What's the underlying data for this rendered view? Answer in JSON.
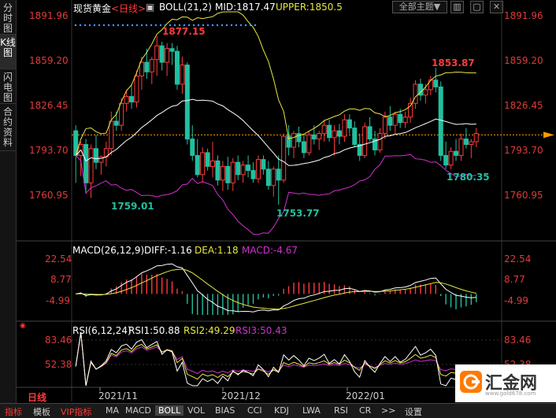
{
  "sidebar": {
    "tabs": [
      "分时图",
      "K线图",
      "闪电图",
      "合约资料"
    ]
  },
  "header": {
    "symbol": "现货黄金",
    "period": "<日线>",
    "boll": "BOLL(21,2)",
    "mid": "MID:1817.47",
    "upper": "UPPER:1850.5",
    "theme_select": "全部主题▼",
    "ctrl_icons": [
      "▥",
      "▢",
      "✕"
    ]
  },
  "price_axis": {
    "left": [
      "1891.96",
      "1859.20",
      "1826.45",
      "1793.70",
      "1760.95"
    ],
    "right": [
      "1891.96",
      "1859.20",
      "1826.45",
      "1793.70",
      "1760.95"
    ]
  },
  "annotations": {
    "high1": "1877.15",
    "low1": "1759.01",
    "low2": "1753.77",
    "high2": "1853.87",
    "low3": "1780.35"
  },
  "macd_header": {
    "name": "MACD(26,12,9)",
    "diff": "DIFF:-1.16",
    "dea": "DEA:1.18",
    "macd": "MACD:-4.67"
  },
  "macd_axis": [
    "22.54",
    "8.77",
    "-4.99"
  ],
  "rsi_header": {
    "name": "RSI(6,12,24)",
    "rsi1": "RSI1:50.88",
    "rsi2": "RSI2:49.29",
    "rsi3": "RSI3:50.43"
  },
  "rsi_axis": [
    "83.46",
    "52.38"
  ],
  "time_axis": {
    "period_label": "日线",
    "dates": [
      "2021/11",
      "2021/12",
      "2022/01",
      "2"
    ]
  },
  "bottom_tabs": [
    "指标",
    "模板",
    "VIP指标",
    "MA",
    "MACD",
    "BOLL",
    "VOL",
    "BIAS",
    "CCI",
    "KDJ",
    "LWA",
    "RSI",
    "CR",
    ">>",
    "设置"
  ],
  "logo": {
    "text": "汇金网",
    "url": "www.gold678.com"
  },
  "colors": {
    "up": "#ff3b3b",
    "down": "#20c0a0",
    "mid": "#ffffff",
    "upper_band": "#e8e840",
    "lower_band": "#d030d0",
    "axis": "#e03a3a",
    "current": "#ff9900"
  },
  "chart_data": {
    "type": "candlestick",
    "title": "现货黄金 日线",
    "ylim": [
      1740,
      1895
    ],
    "current_price": 1805,
    "candles": [
      [
        1808,
        1812,
        1770,
        1790
      ],
      [
        1790,
        1800,
        1775,
        1798
      ],
      [
        1798,
        1802,
        1762,
        1770
      ],
      [
        1770,
        1798,
        1759,
        1795
      ],
      [
        1795,
        1805,
        1780,
        1785
      ],
      [
        1785,
        1790,
        1776,
        1789
      ],
      [
        1789,
        1800,
        1782,
        1795
      ],
      [
        1795,
        1822,
        1790,
        1815
      ],
      [
        1815,
        1822,
        1808,
        1812
      ],
      [
        1812,
        1832,
        1808,
        1828
      ],
      [
        1828,
        1838,
        1822,
        1833
      ],
      [
        1833,
        1842,
        1824,
        1829
      ],
      [
        1829,
        1852,
        1825,
        1848
      ],
      [
        1848,
        1862,
        1838,
        1858
      ],
      [
        1858,
        1868,
        1846,
        1851
      ],
      [
        1851,
        1862,
        1842,
        1860
      ],
      [
        1860,
        1877,
        1848,
        1870
      ],
      [
        1870,
        1873,
        1852,
        1858
      ],
      [
        1858,
        1872,
        1848,
        1868
      ],
      [
        1868,
        1872,
        1856,
        1866
      ],
      [
        1866,
        1870,
        1838,
        1842
      ],
      [
        1842,
        1862,
        1835,
        1856
      ],
      [
        1856,
        1858,
        1798,
        1802
      ],
      [
        1802,
        1812,
        1786,
        1790
      ],
      [
        1790,
        1802,
        1774,
        1776
      ],
      [
        1776,
        1796,
        1770,
        1792
      ],
      [
        1792,
        1795,
        1779,
        1782
      ],
      [
        1782,
        1800,
        1774,
        1786
      ],
      [
        1786,
        1790,
        1768,
        1772
      ],
      [
        1772,
        1786,
        1764,
        1782
      ],
      [
        1782,
        1789,
        1765,
        1770
      ],
      [
        1770,
        1788,
        1764,
        1785
      ],
      [
        1785,
        1790,
        1772,
        1776
      ],
      [
        1776,
        1786,
        1770,
        1783
      ],
      [
        1783,
        1790,
        1774,
        1779
      ],
      [
        1779,
        1785,
        1770,
        1773
      ],
      [
        1773,
        1790,
        1770,
        1787
      ],
      [
        1787,
        1790,
        1776,
        1780
      ],
      [
        1780,
        1786,
        1765,
        1768
      ],
      [
        1768,
        1782,
        1760,
        1780
      ],
      [
        1780,
        1790,
        1754,
        1772
      ],
      [
        1772,
        1806,
        1770,
        1804
      ],
      [
        1804,
        1812,
        1790,
        1796
      ],
      [
        1796,
        1808,
        1788,
        1806
      ],
      [
        1806,
        1811,
        1796,
        1800
      ],
      [
        1800,
        1806,
        1788,
        1792
      ],
      [
        1792,
        1808,
        1790,
        1805
      ],
      [
        1805,
        1812,
        1798,
        1802
      ],
      [
        1802,
        1808,
        1794,
        1806
      ],
      [
        1806,
        1816,
        1800,
        1812
      ],
      [
        1812,
        1816,
        1800,
        1803
      ],
      [
        1803,
        1812,
        1790,
        1808
      ],
      [
        1808,
        1813,
        1798,
        1804
      ],
      [
        1804,
        1820,
        1800,
        1816
      ],
      [
        1816,
        1820,
        1806,
        1810
      ],
      [
        1810,
        1815,
        1796,
        1798
      ],
      [
        1798,
        1806,
        1786,
        1790
      ],
      [
        1790,
        1814,
        1788,
        1811
      ],
      [
        1811,
        1818,
        1800,
        1802
      ],
      [
        1802,
        1808,
        1790,
        1794
      ],
      [
        1794,
        1810,
        1792,
        1806
      ],
      [
        1806,
        1822,
        1802,
        1818
      ],
      [
        1818,
        1826,
        1808,
        1812
      ],
      [
        1812,
        1822,
        1806,
        1820
      ],
      [
        1820,
        1824,
        1810,
        1814
      ],
      [
        1814,
        1822,
        1810,
        1818
      ],
      [
        1818,
        1832,
        1814,
        1828
      ],
      [
        1828,
        1845,
        1824,
        1842
      ],
      [
        1842,
        1846,
        1830,
        1834
      ],
      [
        1834,
        1842,
        1828,
        1838
      ],
      [
        1838,
        1848,
        1834,
        1845
      ],
      [
        1845,
        1854,
        1836,
        1840
      ],
      [
        1840,
        1844,
        1786,
        1790
      ],
      [
        1790,
        1800,
        1780,
        1783
      ],
      [
        1783,
        1796,
        1780,
        1793
      ],
      [
        1793,
        1802,
        1786,
        1790
      ],
      [
        1790,
        1806,
        1786,
        1802
      ],
      [
        1802,
        1810,
        1795,
        1798
      ],
      [
        1798,
        1802,
        1788,
        1800
      ],
      [
        1800,
        1810,
        1796,
        1806
      ]
    ],
    "macd": {
      "diff": [],
      "dea": []
    },
    "rsi": {
      "rsi1": [],
      "rsi2": [],
      "rsi3": []
    }
  }
}
